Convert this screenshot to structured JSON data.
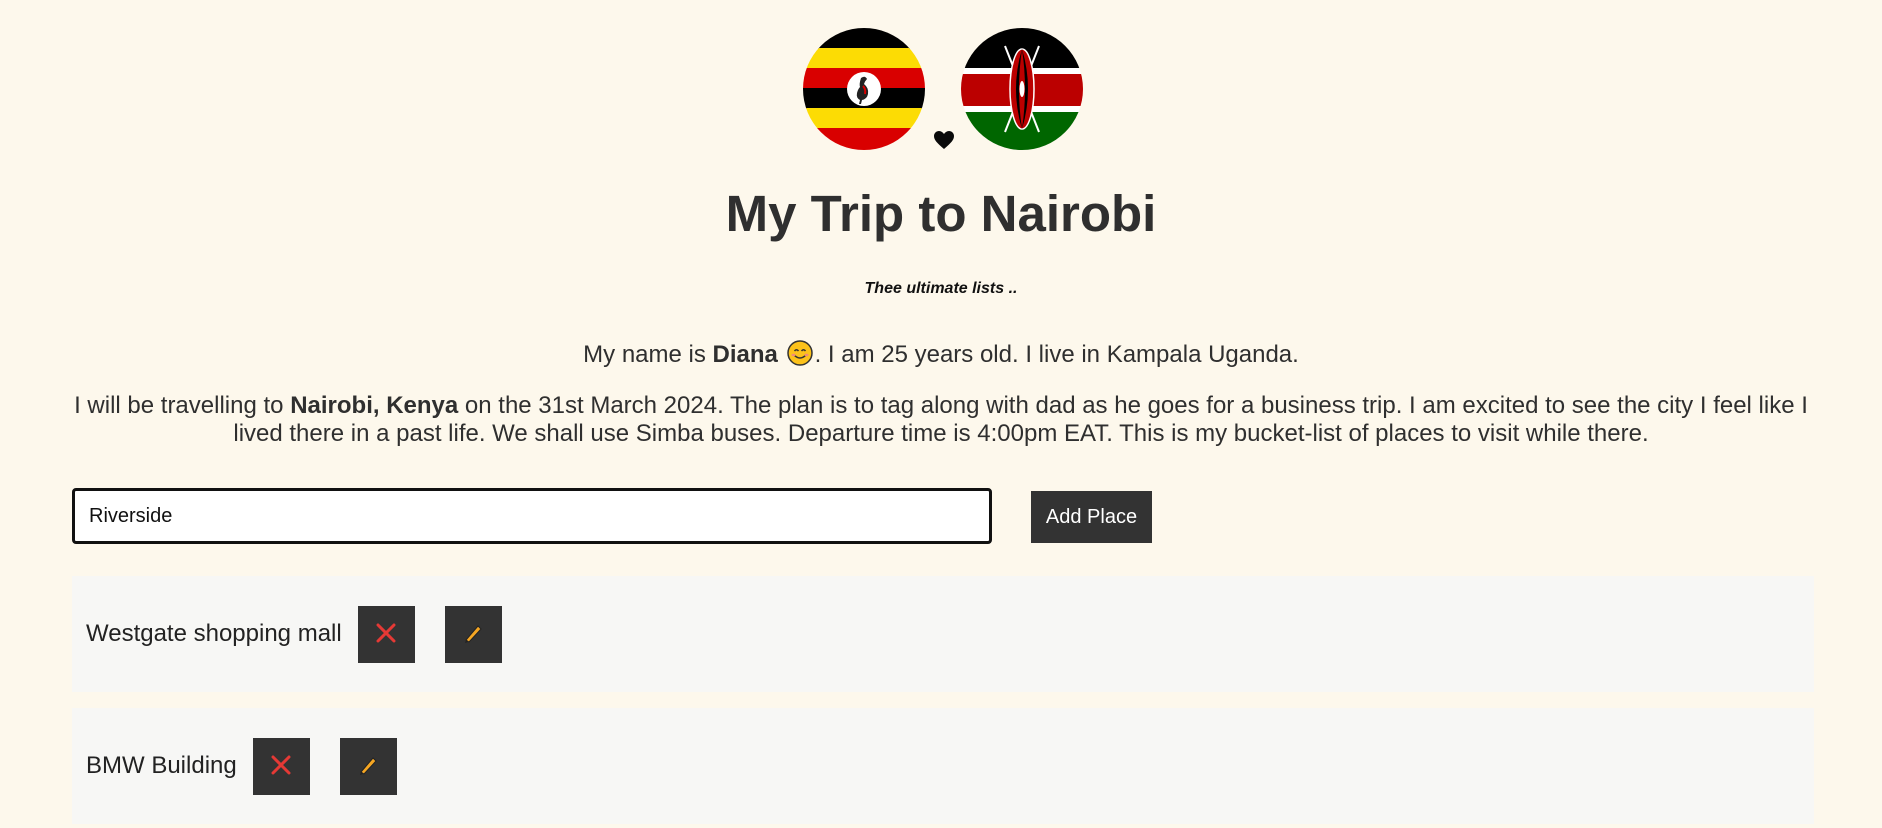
{
  "header": {
    "flags": [
      {
        "name": "Uganda",
        "icon": "uganda-flag-icon"
      },
      {
        "name": "Kenya",
        "icon": "kenya-flag-icon"
      }
    ],
    "heart_icon": "heart-icon",
    "title": "My Trip to Nairobi",
    "tagline": "Thee ultimate lists .."
  },
  "intro": {
    "prefix": "My name is",
    "name": "Diana",
    "emoji": "smiling-face-icon",
    "suffix": ". I am 25 years old. I live in Kampala Uganda."
  },
  "trip": {
    "prefix": "I will be travelling to",
    "destination": "Nairobi, Kenya",
    "suffix": "on the 31st March 2024. The plan is to tag along with dad as he goes for a business trip. I am excited to see the city I feel like I lived there in a past life. We shall use Simba buses. Departure time is 4:00pm EAT. This is my bucket-list of places to visit while there."
  },
  "form": {
    "input_value": "Riverside",
    "add_label": "Add Place"
  },
  "places": [
    {
      "name": "Westgate shopping mall",
      "delete_icon": "close-icon",
      "edit_icon": "pencil-icon"
    },
    {
      "name": "BMW Building",
      "delete_icon": "close-icon",
      "edit_icon": "pencil-icon"
    }
  ],
  "colors": {
    "background": "#fdf8ec",
    "button": "#333333",
    "delete_icon": "#e53935",
    "edit_icon": "#f5a623",
    "list_item_bg": "#f7f7f5"
  }
}
